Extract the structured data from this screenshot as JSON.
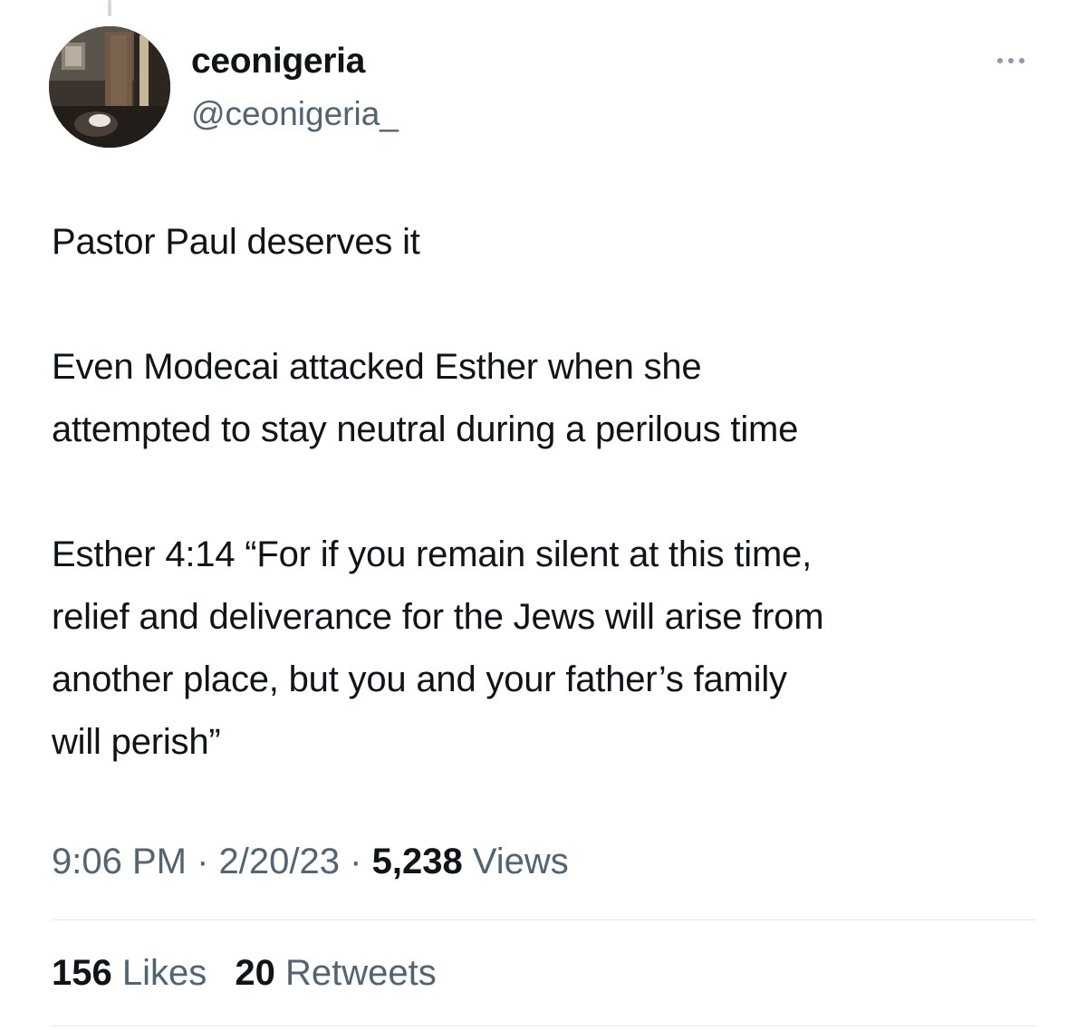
{
  "tweet": {
    "author": {
      "display_name": "ceonigeria",
      "handle": "@ceonigeria_"
    },
    "more_icon": "more-horizontal-icon",
    "text": {
      "para1": "Pastor Paul deserves it",
      "para2_line1": "Even Modecai attacked Esther when she",
      "para2_line2": "attempted to stay neutral during a perilous time",
      "para3_line1": "Esther 4:14 “For if you remain silent at this time,",
      "para3_line2": "relief and deliverance for the Jews will arise from",
      "para3_line3": "another place, but you and your father’s family",
      "para3_line4": "will perish”"
    },
    "meta": {
      "time": "9:06 PM",
      "separator": "·",
      "date": "2/20/23",
      "views_count": "5,238",
      "views_label": "Views"
    },
    "stats": {
      "likes_count": "156",
      "likes_label": "Likes",
      "retweets_count": "20",
      "retweets_label": "Retweets"
    },
    "colors": {
      "primary_text": "#0f1419",
      "secondary_text": "#536471",
      "divider": "#e3e8ec"
    }
  }
}
